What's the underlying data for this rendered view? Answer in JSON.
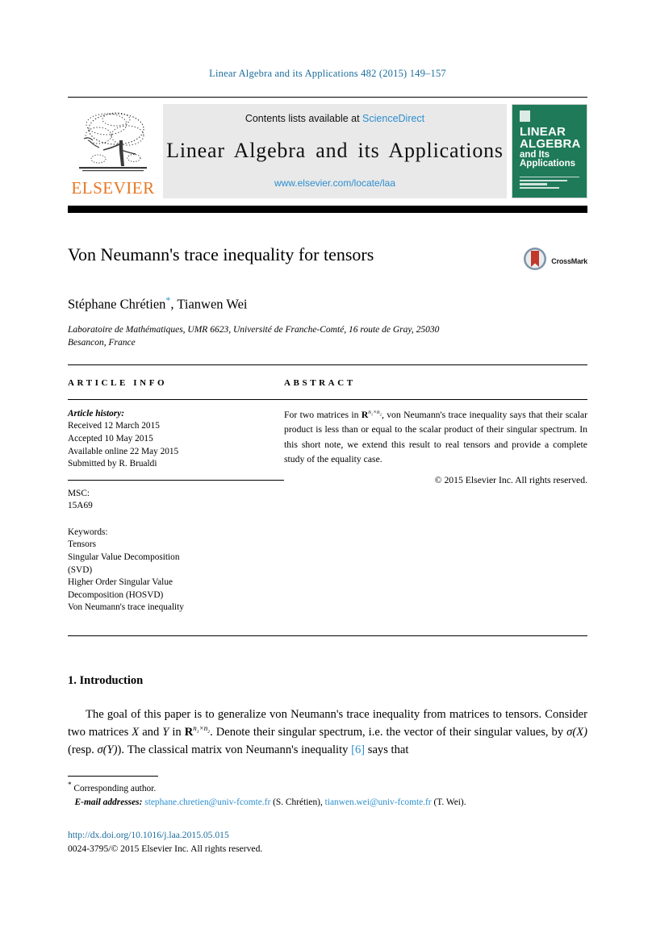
{
  "running_head": "Linear Algebra and its Applications 482 (2015) 149–157",
  "masthead": {
    "publisher_wordmark": "ELSEVIER",
    "contents_prefix": "Contents lists available at ",
    "contents_link": "ScienceDirect",
    "journal_title": "Linear Algebra and its Applications",
    "journal_url": "www.elsevier.com/locate/laa",
    "cover": {
      "line1": "LINEAR",
      "line2": "ALGEBRA",
      "line3": "and Its",
      "line4": "Applications"
    }
  },
  "article": {
    "title": "Von Neumann's trace inequality for tensors",
    "authors": "Stéphane Chrétien",
    "authors_rest": ", Tianwen Wei",
    "corresponding_marker": "*",
    "affiliation": "Laboratoire de Mathématiques, UMR 6623, Université de Franche-Comté, 16 route de Gray, 25030 Besancon, France",
    "crossmark_label": "CrossMark"
  },
  "info": {
    "heading": "ARTICLE INFO",
    "history_label": "Article history:",
    "history": [
      "Received 12 March 2015",
      "Accepted 10 May 2015",
      "Available online 22 May 2015",
      "Submitted by R. Brualdi"
    ],
    "msc_label": "MSC:",
    "msc_value": "15A69",
    "keywords_label": "Keywords:",
    "keywords": [
      "Tensors",
      "Singular Value Decomposition",
      "(SVD)",
      "Higher Order Singular Value",
      "Decomposition (HOSVD)",
      "Von Neumann's trace inequality"
    ]
  },
  "abstract": {
    "heading": "ABSTRACT",
    "part1": "For two matrices in ",
    "math1_R": "R",
    "math1_sup": "n",
    "math1_sup_1": "1",
    "math1_times": "×n",
    "math1_sup_2": "2",
    "part2": ", von Neumann's trace inequality says that their scalar product is less than or equal to the scalar product of their singular spectrum. In this short note, we extend this result to real tensors and provide a complete study of the equality case.",
    "copyright": "© 2015 Elsevier Inc. All rights reserved."
  },
  "body": {
    "section_number_title": "1. Introduction",
    "p1_a": "The goal of this paper is to generalize von Neumann's trace inequality from matrices to tensors. Consider two matrices ",
    "p1_X": "X",
    "p1_b": " and ",
    "p1_Y": "Y",
    "p1_c": " in ",
    "p1_R": "R",
    "p1_sup_n": "n",
    "p1_sup_1": "1",
    "p1_times": "×n",
    "p1_sup_2": "2",
    "p1_d": ". Denote their singular spectrum, i.e. the vector of their singular values, by ",
    "p1_sigX": "σ(X)",
    "p1_e": " (resp. ",
    "p1_sigY": "σ(Y)",
    "p1_f": "). The classical matrix von Neumann's inequality ",
    "p1_cite": "[6]",
    "p1_g": " says that"
  },
  "footnotes": {
    "marker": "*",
    "corresponding": "Corresponding author.",
    "emails_label": "E-mail addresses:",
    "email1": "stephane.chretien@univ-fcomte.fr",
    "email1_owner": "(S. Chrétien),",
    "email2": "tianwen.wei@univ-fcomte.fr",
    "email2_owner": "(T. Wei)."
  },
  "footer": {
    "doi": "http://dx.doi.org/10.1016/j.laa.2015.05.015",
    "issn_line": "0024-3795/© 2015 Elsevier Inc. All rights reserved."
  },
  "colors": {
    "link_blue": "#2C8ECF",
    "head_blue": "#1a6c9c",
    "elsevier_orange": "#E87722",
    "cover_green": "#1f7a5a"
  }
}
